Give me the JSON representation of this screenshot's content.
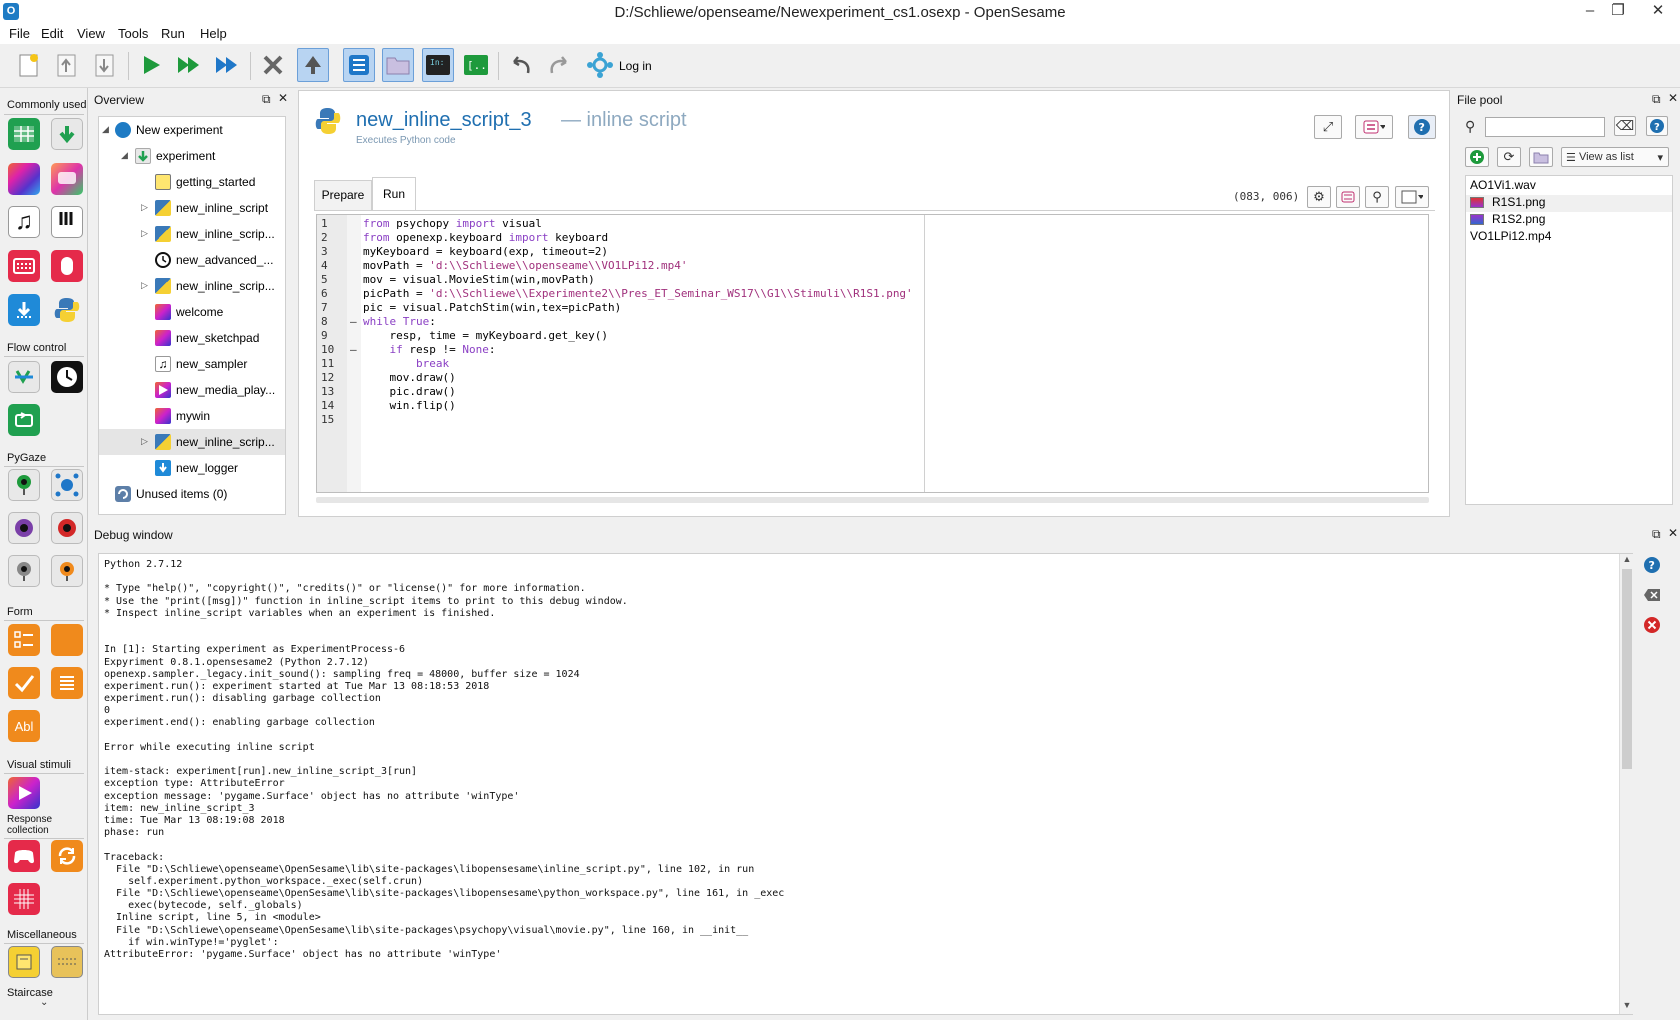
{
  "window": {
    "title": "D:/Schliewe/openseame/Newexperiment_cs1.osexp - OpenSesame",
    "minimize": "–",
    "restore": "❐",
    "close": "✕"
  },
  "menu": [
    "File",
    "Edit",
    "View",
    "Tools",
    "Run",
    "Help"
  ],
  "toolbar": {
    "login_label": "Log in"
  },
  "toolbox": {
    "sections": [
      "Commonly used",
      "Flow control",
      "PyGaze",
      "Form",
      "Visual stimuli",
      "Response collection",
      "Miscellaneous",
      "Staircase"
    ],
    "form_text_icon": "Abl"
  },
  "overview": {
    "title": "Overview",
    "items": [
      {
        "label": "New experiment",
        "icon": "opensesame-icon"
      },
      {
        "label": "experiment",
        "icon": "sequence-icon"
      },
      {
        "label": "getting_started",
        "icon": "notepad-icon"
      },
      {
        "label": "new_inline_script",
        "icon": "python-icon"
      },
      {
        "label": "new_inline_scrip...",
        "icon": "python-icon"
      },
      {
        "label": "new_advanced_...",
        "icon": "clock-icon"
      },
      {
        "label": "new_inline_scrip...",
        "icon": "python-icon"
      },
      {
        "label": "welcome",
        "icon": "sketchpad-icon"
      },
      {
        "label": "new_sketchpad",
        "icon": "sketchpad-icon"
      },
      {
        "label": "new_sampler",
        "icon": "sampler-icon"
      },
      {
        "label": "new_media_play...",
        "icon": "media-icon"
      },
      {
        "label": "mywin",
        "icon": "sketchpad-icon"
      },
      {
        "label": "new_inline_scrip...",
        "icon": "python-icon"
      },
      {
        "label": "new_logger",
        "icon": "logger-icon"
      },
      {
        "label": "Unused items (0)",
        "icon": "unused-icon"
      }
    ]
  },
  "editor": {
    "item_name": "new_inline_script_3",
    "item_type": "— inline script",
    "subtitle": "Executes Python code",
    "tabs": [
      "Prepare",
      "Run"
    ],
    "active_tab": "Run",
    "cursor_pos": "(083, 006)",
    "line_numbers": [
      "1",
      "2",
      "3",
      "4",
      "5",
      "6",
      "7",
      "8",
      "9",
      "10",
      "11",
      "12",
      "13",
      "14",
      "15"
    ],
    "fold_markers": [
      "",
      "",
      "",
      "",
      "",
      "",
      "",
      "–",
      "",
      "–",
      "",
      "",
      "",
      "",
      ""
    ],
    "code": [
      "from psychopy import visual",
      "from openexp.keyboard import keyboard",
      "myKeyboard = keyboard(exp, timeout=2)",
      "movPath = 'd:\\\\Schliewe\\\\openseame\\\\VO1LPi12.mp4'",
      "mov = visual.MovieStim(win,movPath)",
      "picPath = 'd:\\\\Schliewe\\\\Experimente2\\\\Pres_ET_Seminar_WS17\\\\G1\\\\Stimuli\\\\R1S1.png'",
      "pic = visual.PatchStim(win,tex=picPath)",
      "while True:",
      "    resp, time = myKeyboard.get_key()",
      "    if resp != None:",
      "        break",
      "    mov.draw()",
      "    pic.draw()",
      "    win.flip()",
      ""
    ]
  },
  "filepool": {
    "title": "File pool",
    "view_label": "View as list",
    "search_value": "",
    "files": [
      {
        "name": "AO1Vi1.wav",
        "icon": ""
      },
      {
        "name": "R1S1.png",
        "icon": "image-icon"
      },
      {
        "name": "R1S2.png",
        "icon": "image-icon"
      },
      {
        "name": "VO1LPi12.mp4",
        "icon": ""
      }
    ]
  },
  "debug": {
    "title": "Debug window",
    "lines": [
      "Python 2.7.12",
      "",
      "* Type \"help()\", \"copyright()\", \"credits()\" or \"license()\" for more information.",
      "* Use the \"print([msg])\" function in inline_script items to print to this debug window.",
      "* Inspect inline_script variables when an experiment is finished.",
      "",
      "",
      "In [1]: Starting experiment as ExperimentProcess-6",
      "Expyriment 0.8.1.opensesame2 (Python 2.7.12)",
      "openexp.sampler._legacy.init_sound(): sampling freq = 48000, buffer size = 1024",
      "experiment.run(): experiment started at Tue Mar 13 08:18:53 2018",
      "experiment.run(): disabling garbage collection",
      "0",
      "experiment.end(): enabling garbage collection",
      "",
      "Error while executing inline script",
      "",
      "item-stack: experiment[run].new_inline_script_3[run]",
      "exception type: AttributeError",
      "exception message: 'pygame.Surface' object has no attribute 'winType'",
      "item: new_inline_script_3",
      "time: Tue Mar 13 08:19:08 2018",
      "phase: run",
      "",
      "Traceback:",
      "  File \"D:\\Schliewe\\openseame\\OpenSesame\\lib\\site-packages\\libopensesame\\inline_script.py\", line 102, in run",
      "    self.experiment.python_workspace._exec(self.crun)",
      "  File \"D:\\Schliewe\\openseame\\OpenSesame\\lib\\site-packages\\libopensesame\\python_workspace.py\", line 161, in _exec",
      "    exec(bytecode, self._globals)",
      "  Inline script, line 5, in <module>",
      "  File \"D:\\Schliewe\\openseame\\OpenSesame\\lib\\site-packages\\psychopy\\visual\\movie.py\", line 160, in __init__",
      "    if win.winType!='pyglet':",
      "AttributeError: 'pygame.Surface' object has no attribute 'winType'"
    ]
  }
}
